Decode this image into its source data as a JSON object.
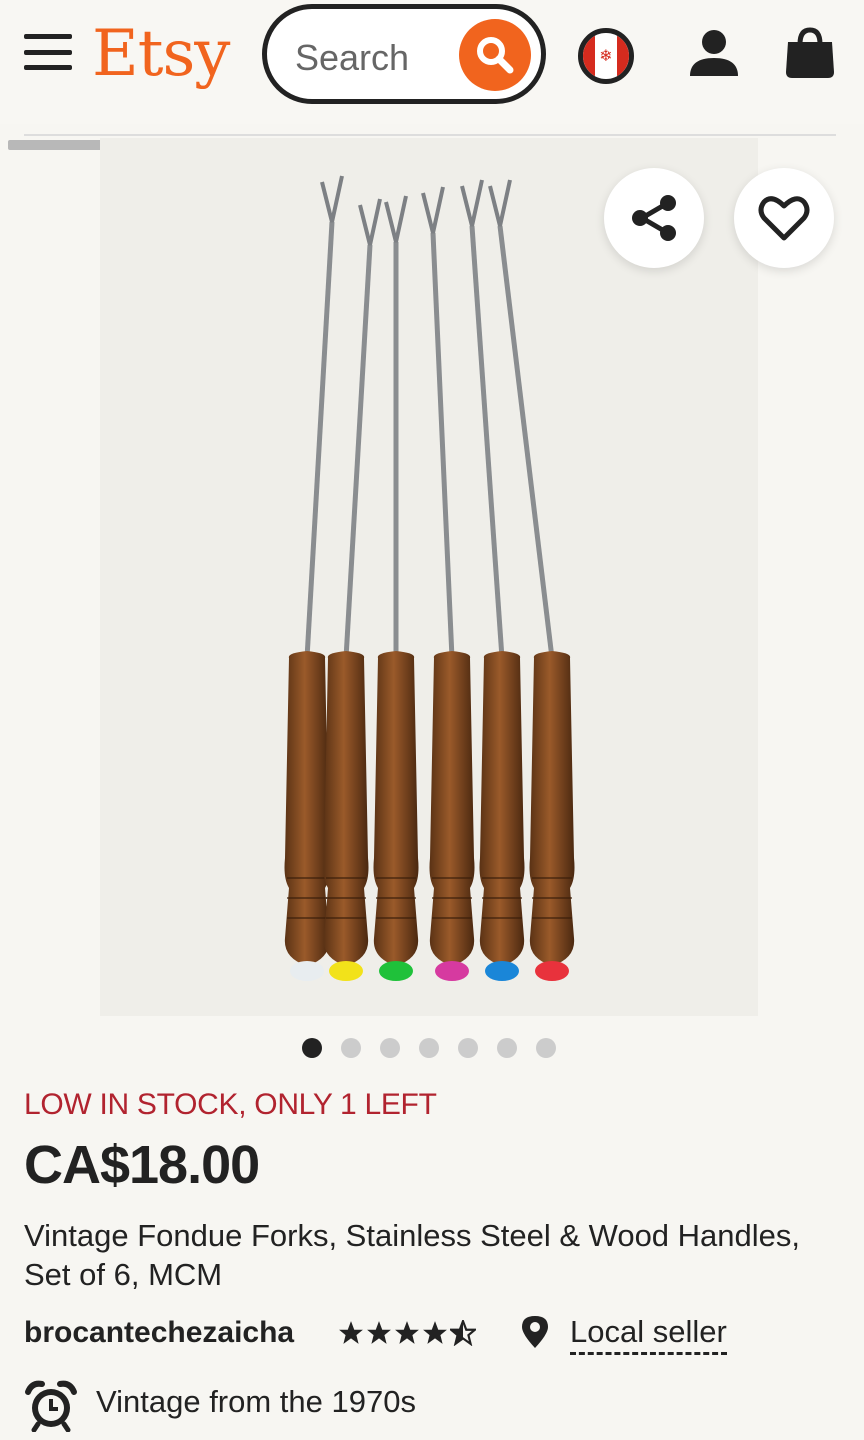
{
  "header": {
    "logo": "Etsy",
    "search_placeholder": "Search",
    "region_flag": "canada-flag-icon",
    "icons": [
      "menu-icon",
      "search-icon",
      "account-icon",
      "cart-icon"
    ],
    "brand_color": "#f1641e"
  },
  "gallery": {
    "image_count": 7,
    "active_index": 0,
    "actions": [
      "share-icon",
      "heart-icon"
    ],
    "handle_tip_colors": [
      "#e8edf0",
      "#f2e21a",
      "#1fc13a",
      "#d63aa0",
      "#1a86d8",
      "#e8323c"
    ]
  },
  "product": {
    "stock_notice": "LOW IN STOCK, ONLY 1 LEFT",
    "price": "CA$18.00",
    "title": "Vintage Fondue Forks, Stainless Steel & Wood Handles, Set of 6, MCM",
    "seller": "brocantechezaicha",
    "rating": 4.5,
    "local_seller": "Local seller",
    "vintage_note": "Vintage from the 1970s"
  }
}
